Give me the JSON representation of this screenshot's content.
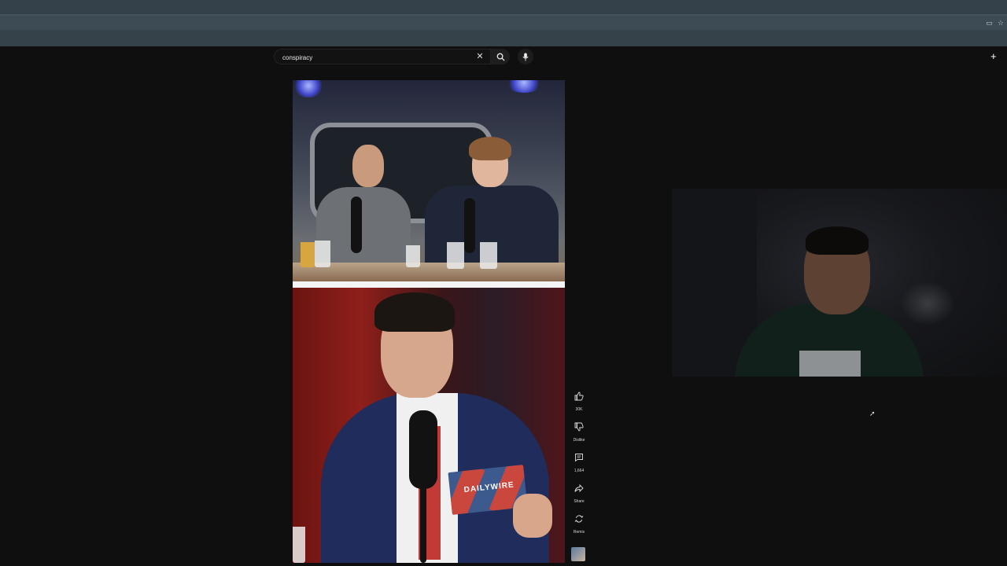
{
  "browser": {
    "icons": [
      "screen-share-icon",
      "star-icon"
    ]
  },
  "search": {
    "value": "conspiracy",
    "placeholder": "Search"
  },
  "header": {
    "create_icon": "plus-icon"
  },
  "video": {
    "card_text": "DAILYWIRE"
  },
  "actions": {
    "like_count": "30K",
    "dislike_label": "Dislike",
    "comment_count": "1,664",
    "share_label": "Share",
    "remix_label": "Remix"
  },
  "colors": {
    "background": "#0f0f0f",
    "browser_chrome": "#35414a",
    "text": "#f1f1f1"
  }
}
